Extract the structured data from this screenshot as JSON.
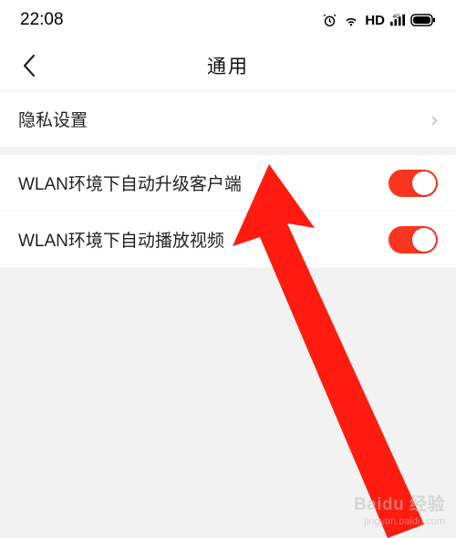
{
  "status_bar": {
    "time": "22:08",
    "hd_label": "HD"
  },
  "nav": {
    "title": "通用"
  },
  "rows": {
    "privacy": {
      "label": "隐私设置"
    },
    "auto_upgrade": {
      "label": "WLAN环境下自动升级客户端",
      "on": true
    },
    "auto_play": {
      "label": "WLAN环境下自动播放视频",
      "on": true
    }
  },
  "watermark": {
    "brand": "Baidu 经验",
    "url": "jingyan.baidu.com"
  }
}
